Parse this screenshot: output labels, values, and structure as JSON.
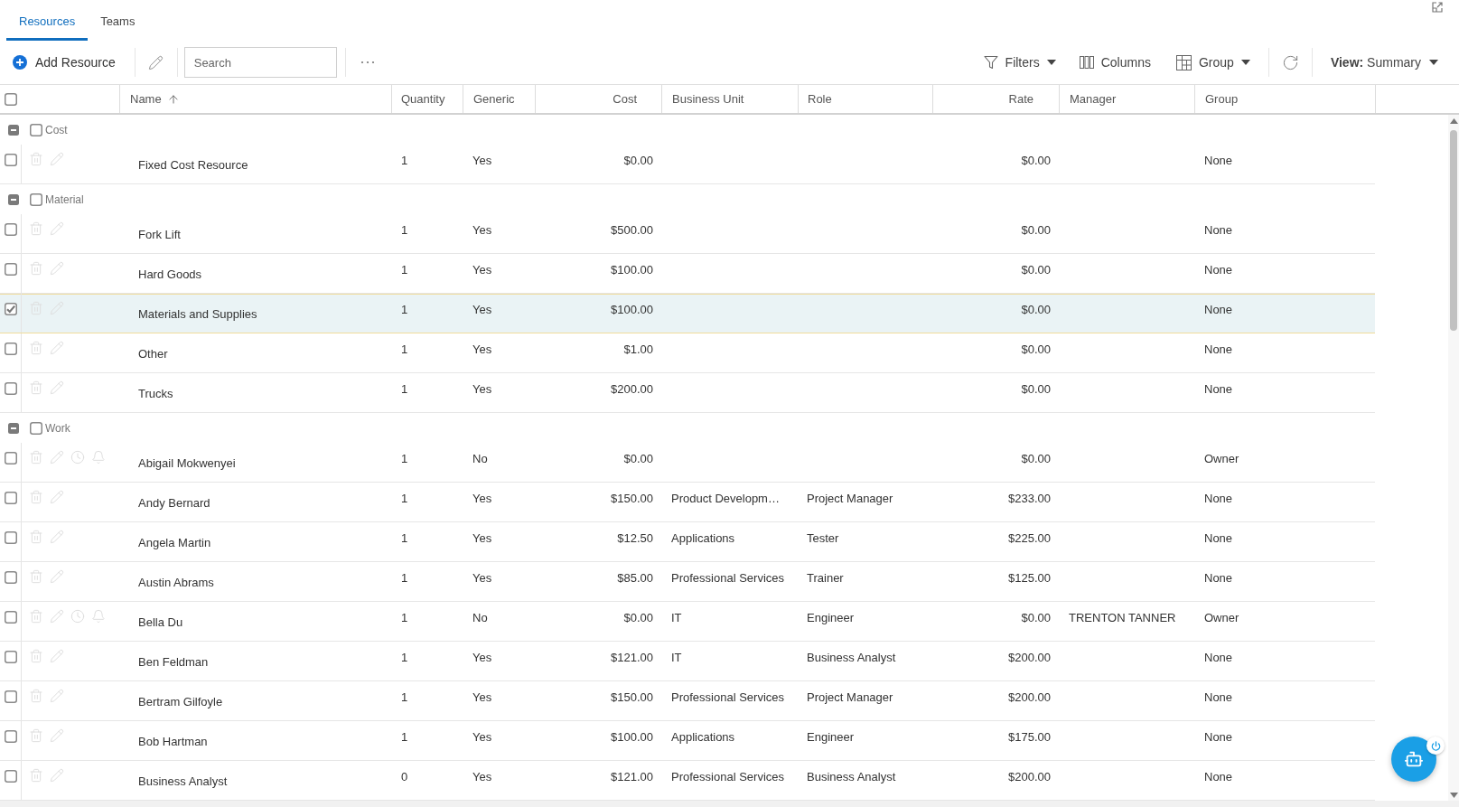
{
  "tabs": [
    {
      "label": "Resources",
      "selected": true
    },
    {
      "label": "Teams",
      "selected": false
    }
  ],
  "toolbar": {
    "add_button": "Add Resource",
    "search": {
      "placeholder": "Search"
    },
    "filters_button": "Filters",
    "columns_button": "Columns",
    "group_button": "Group",
    "view_button": "**View:** Summary"
  },
  "table": {
    "select_all": {
      "checked": false
    },
    "columns": [
      {
        "label": "Name",
        "sorted": true
      },
      {
        "label": "Quantity",
        "sorted": false
      },
      {
        "label": "Generic",
        "sorted": false
      },
      {
        "label": "Cost",
        "sorted": false
      },
      {
        "label": "Business Unit",
        "sorted": false
      },
      {
        "label": "Role",
        "sorted": false
      },
      {
        "label": "Rate",
        "sorted": false
      },
      {
        "label": "Manager",
        "sorted": false
      },
      {
        "label": "Group",
        "sorted": false
      }
    ],
    "groups": [
      {
        "label": "Cost",
        "expanded": true,
        "checked": false,
        "rows": [
          {
            "kind": "resource",
            "selected": false,
            "name": "Fixed Cost Resource",
            "quantity": "1",
            "generic": "Yes",
            "cost": "$0.00",
            "rate": "$0.00",
            "group": "None"
          }
        ]
      },
      {
        "label": "Material",
        "expanded": true,
        "checked": false,
        "rows": [
          {
            "kind": "resource",
            "selected": false,
            "name": "Fork Lift",
            "quantity": "1",
            "generic": "Yes",
            "cost": "$500.00",
            "rate": "$0.00",
            "group": "None"
          },
          {
            "kind": "resource",
            "selected": false,
            "name": "Hard Goods",
            "quantity": "1",
            "generic": "Yes",
            "cost": "$100.00",
            "rate": "$0.00",
            "group": "None"
          },
          {
            "kind": "resource",
            "selected": true,
            "name": "Materials and Supplies",
            "quantity": "1",
            "generic": "Yes",
            "cost": "$100.00",
            "rate": "$0.00",
            "group": "None"
          },
          {
            "kind": "resource",
            "selected": false,
            "name": "Other",
            "quantity": "1",
            "generic": "Yes",
            "cost": "$1.00",
            "rate": "$0.00",
            "group": "None"
          },
          {
            "kind": "resource",
            "selected": false,
            "name": "Trucks",
            "quantity": "1",
            "generic": "Yes",
            "cost": "$200.00",
            "rate": "$0.00",
            "group": "None"
          }
        ]
      },
      {
        "label": "Work",
        "expanded": true,
        "checked": false,
        "rows": [
          {
            "kind": "user",
            "selected": false,
            "name": "Abigail Mokwenyei",
            "quantity": "1",
            "generic": "No",
            "cost": "$0.00",
            "rate": "$0.00",
            "group": "Owner"
          },
          {
            "kind": "resource",
            "selected": false,
            "name": "Andy Bernard",
            "quantity": "1",
            "generic": "Yes",
            "cost": "$150.00",
            "business_unit": "Product Developm…",
            "role": "Project Manager",
            "rate": "$233.00",
            "group": "None"
          },
          {
            "kind": "resource",
            "selected": false,
            "name": "Angela Martin",
            "quantity": "1",
            "generic": "Yes",
            "cost": "$12.50",
            "business_unit": "Applications",
            "role": "Tester",
            "rate": "$225.00",
            "group": "None"
          },
          {
            "kind": "resource",
            "selected": false,
            "name": "Austin Abrams",
            "quantity": "1",
            "generic": "Yes",
            "cost": "$85.00",
            "business_unit": "Professional Services",
            "role": "Trainer",
            "rate": "$125.00",
            "group": "None"
          },
          {
            "kind": "user",
            "selected": false,
            "name": "Bella Du",
            "quantity": "1",
            "generic": "No",
            "cost": "$0.00",
            "business_unit": "IT",
            "role": "Engineer",
            "rate": "$0.00",
            "manager": "TRENTON TANNER",
            "group": "Owner"
          },
          {
            "kind": "resource",
            "selected": false,
            "name": "Ben Feldman",
            "quantity": "1",
            "generic": "Yes",
            "cost": "$121.00",
            "business_unit": "IT",
            "role": "Business Analyst",
            "rate": "$200.00",
            "group": "None"
          },
          {
            "kind": "resource",
            "selected": false,
            "name": "Bertram Gilfoyle",
            "quantity": "1",
            "generic": "Yes",
            "cost": "$150.00",
            "business_unit": "Professional Services",
            "role": "Project Manager",
            "rate": "$200.00",
            "group": "None"
          },
          {
            "kind": "resource",
            "selected": false,
            "name": "Bob Hartman",
            "quantity": "1",
            "generic": "Yes",
            "cost": "$100.00",
            "business_unit": "Applications",
            "role": "Engineer",
            "rate": "$175.00",
            "group": "None"
          },
          {
            "kind": "resource",
            "selected": false,
            "name": "Business Analyst",
            "quantity": "0",
            "generic": "Yes",
            "cost": "$121.00",
            "business_unit": "Professional Services",
            "role": "Business Analyst",
            "rate": "$200.00",
            "group": "None"
          }
        ]
      }
    ]
  }
}
